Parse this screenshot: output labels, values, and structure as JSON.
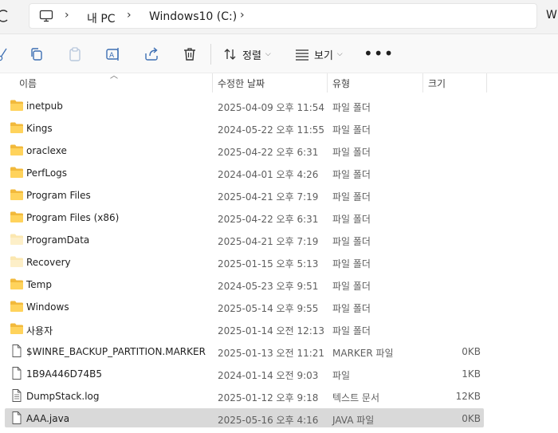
{
  "address_bar": {
    "crumbs": [
      "내 PC",
      "Windows10 (C:)"
    ],
    "right_peek": "W"
  },
  "toolbar": {
    "sort_label": "정렬",
    "view_label": "보기",
    "more_label": "•••",
    "icons": [
      "cut-icon",
      "copy-icon",
      "paste-icon",
      "rename-icon",
      "share-icon",
      "delete-icon"
    ]
  },
  "columns": {
    "name": "이름",
    "date": "수정한 날짜",
    "type": "유형",
    "size": "크기"
  },
  "files": [
    {
      "name": "inetpub",
      "date": "2025-04-09 오후 11:54",
      "type": "파일 폴더",
      "size": "",
      "kind": "folder"
    },
    {
      "name": "Kings",
      "date": "2024-05-22 오후 11:55",
      "type": "파일 폴더",
      "size": "",
      "kind": "folder"
    },
    {
      "name": "oraclexe",
      "date": "2025-04-22 오후 6:31",
      "type": "파일 폴더",
      "size": "",
      "kind": "folder"
    },
    {
      "name": "PerfLogs",
      "date": "2024-04-01 오후 4:26",
      "type": "파일 폴더",
      "size": "",
      "kind": "folder"
    },
    {
      "name": "Program Files",
      "date": "2025-04-21 오후 7:19",
      "type": "파일 폴더",
      "size": "",
      "kind": "folder"
    },
    {
      "name": "Program Files (x86)",
      "date": "2025-04-22 오후 6:31",
      "type": "파일 폴더",
      "size": "",
      "kind": "folder"
    },
    {
      "name": "ProgramData",
      "date": "2025-04-21 오후 7:19",
      "type": "파일 폴더",
      "size": "",
      "kind": "folder-hidden"
    },
    {
      "name": "Recovery",
      "date": "2025-01-15 오후 5:13",
      "type": "파일 폴더",
      "size": "",
      "kind": "folder-hidden"
    },
    {
      "name": "Temp",
      "date": "2024-05-23 오후 9:51",
      "type": "파일 폴더",
      "size": "",
      "kind": "folder"
    },
    {
      "name": "Windows",
      "date": "2025-05-14 오후 9:55",
      "type": "파일 폴더",
      "size": "",
      "kind": "folder"
    },
    {
      "name": "사용자",
      "date": "2025-01-14 오전 12:13",
      "type": "파일 폴더",
      "size": "",
      "kind": "folder"
    },
    {
      "name": "$WINRE_BACKUP_PARTITION.MARKER",
      "date": "2025-01-13 오전 11:21",
      "type": "MARKER 파일",
      "size": "0KB",
      "kind": "file"
    },
    {
      "name": "1B9A446D74B5",
      "date": "2024-01-14 오전 9:03",
      "type": "파일",
      "size": "1KB",
      "kind": "file"
    },
    {
      "name": "DumpStack.log",
      "date": "2025-01-12 오후 9:18",
      "type": "텍스트 문서",
      "size": "12KB",
      "kind": "text-file"
    },
    {
      "name": "AAA.java",
      "date": "2025-05-16 오후 4:16",
      "type": "JAVA 파일",
      "size": "0KB",
      "kind": "file",
      "selected": true
    }
  ]
}
